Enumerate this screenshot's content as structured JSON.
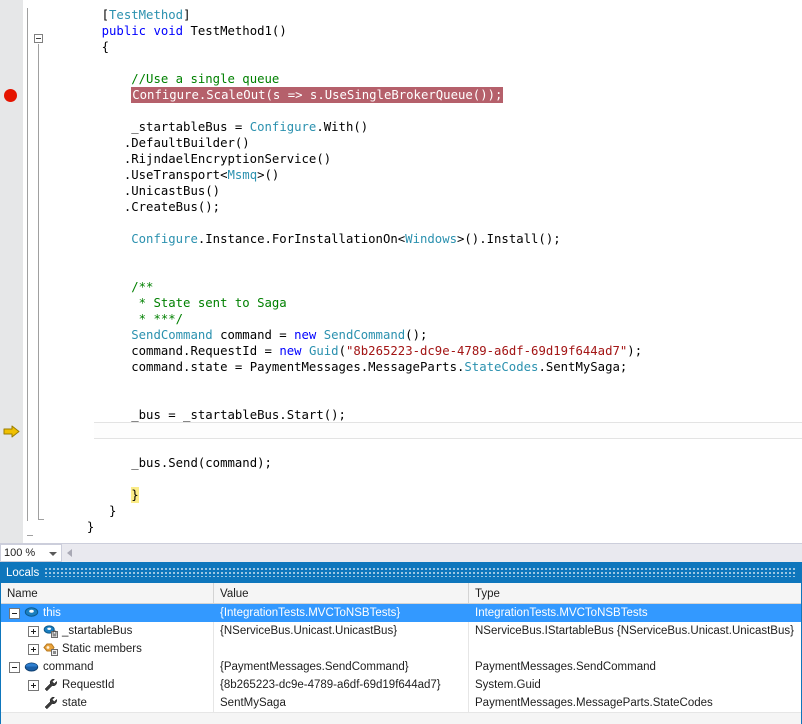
{
  "editor": {
    "language": "csharp",
    "zoom_level": "100 %",
    "breakpoint_line_index": 5,
    "current_statement_line_index": 26,
    "colors": {
      "keyword": "#0000ff",
      "type": "#2b91af",
      "comment": "#008000",
      "string": "#a31515",
      "breakpoint_highlight_bg": "#b5606b",
      "breakpoint_glyph": "#e51400",
      "current_statement_arrow": "#f0c000",
      "brace_match_highlight": "#fbec88"
    },
    "lines": [
      {
        "indent": 4,
        "tokens": [
          {
            "t": "[",
            "c": "p"
          },
          {
            "t": "TestMethod",
            "c": "t"
          },
          {
            "t": "]",
            "c": "p"
          }
        ]
      },
      {
        "indent": 4,
        "outline": "collapse",
        "tokens": [
          {
            "t": "public",
            "c": "k"
          },
          {
            "t": " ",
            "c": "p"
          },
          {
            "t": "void",
            "c": "k"
          },
          {
            "t": " TestMethod1()",
            "c": "p"
          }
        ]
      },
      {
        "indent": 4,
        "tokens": [
          {
            "t": "{",
            "c": "p"
          }
        ]
      },
      {
        "indent": 0,
        "tokens": []
      },
      {
        "indent": 8,
        "tokens": [
          {
            "t": "//Use a single queue",
            "c": "c"
          }
        ]
      },
      {
        "indent": 8,
        "highlight": true,
        "tokens": [
          {
            "t": "Configure.ScaleOut(s => s.UseSingleBrokerQueue());",
            "c": "p"
          }
        ]
      },
      {
        "indent": 0,
        "tokens": []
      },
      {
        "indent": 8,
        "tokens": [
          {
            "t": "_startableBus = ",
            "c": "p"
          },
          {
            "t": "Configure",
            "c": "t"
          },
          {
            "t": ".With()",
            "c": "p"
          }
        ]
      },
      {
        "indent": 7,
        "tokens": [
          {
            "t": ".DefaultBuilder()",
            "c": "p"
          }
        ]
      },
      {
        "indent": 7,
        "tokens": [
          {
            "t": ".RijndaelEncryptionService()",
            "c": "p"
          }
        ]
      },
      {
        "indent": 7,
        "tokens": [
          {
            "t": ".UseTransport<",
            "c": "p"
          },
          {
            "t": "Msmq",
            "c": "t"
          },
          {
            "t": ">()",
            "c": "p"
          }
        ]
      },
      {
        "indent": 7,
        "tokens": [
          {
            "t": ".UnicastBus()",
            "c": "p"
          }
        ]
      },
      {
        "indent": 7,
        "tokens": [
          {
            "t": ".CreateBus();",
            "c": "p"
          }
        ]
      },
      {
        "indent": 0,
        "tokens": []
      },
      {
        "indent": 8,
        "tokens": [
          {
            "t": "Configure",
            "c": "t"
          },
          {
            "t": ".Instance.ForInstallationOn<",
            "c": "p"
          },
          {
            "t": "Windows",
            "c": "t"
          },
          {
            "t": ">().Install();",
            "c": "p"
          }
        ]
      },
      {
        "indent": 0,
        "tokens": []
      },
      {
        "indent": 0,
        "tokens": []
      },
      {
        "indent": 8,
        "tokens": [
          {
            "t": "/**",
            "c": "c"
          }
        ]
      },
      {
        "indent": 9,
        "tokens": [
          {
            "t": "* State sent to Saga",
            "c": "c"
          }
        ]
      },
      {
        "indent": 9,
        "tokens": [
          {
            "t": "* ***/",
            "c": "c"
          }
        ]
      },
      {
        "indent": 8,
        "tokens": [
          {
            "t": "SendCommand",
            "c": "t"
          },
          {
            "t": " command = ",
            "c": "p"
          },
          {
            "t": "new",
            "c": "k"
          },
          {
            "t": " ",
            "c": "p"
          },
          {
            "t": "SendCommand",
            "c": "t"
          },
          {
            "t": "();",
            "c": "p"
          }
        ]
      },
      {
        "indent": 8,
        "tokens": [
          {
            "t": "command.RequestId = ",
            "c": "p"
          },
          {
            "t": "new",
            "c": "k"
          },
          {
            "t": " ",
            "c": "p"
          },
          {
            "t": "Guid",
            "c": "t"
          },
          {
            "t": "(",
            "c": "p"
          },
          {
            "t": "\"8b265223-dc9e-4789-a6df-69d19f644ad7\"",
            "c": "s"
          },
          {
            "t": ");",
            "c": "p"
          }
        ]
      },
      {
        "indent": 8,
        "tokens": [
          {
            "t": "command.state = PaymentMessages.MessageParts.",
            "c": "p"
          },
          {
            "t": "StateCodes",
            "c": "t"
          },
          {
            "t": ".SentMySaga;",
            "c": "p"
          }
        ]
      },
      {
        "indent": 0,
        "tokens": []
      },
      {
        "indent": 0,
        "tokens": []
      },
      {
        "indent": 8,
        "tokens": [
          {
            "t": "_bus = _startableBus.Start();",
            "c": "p"
          }
        ]
      },
      {
        "indent": 0,
        "tokens": []
      },
      {
        "indent": 0,
        "tokens": []
      },
      {
        "indent": 8,
        "tokens": [
          {
            "t": "_bus.Send(command);",
            "c": "p"
          }
        ]
      },
      {
        "indent": 0,
        "tokens": []
      },
      {
        "indent": 8,
        "current": true,
        "tokens": [
          {
            "t": "}",
            "c": "p",
            "brace": true
          }
        ]
      },
      {
        "indent": 5,
        "tokens": [
          {
            "t": "}",
            "c": "p"
          }
        ]
      },
      {
        "indent": 2,
        "tokens": [
          {
            "t": "}",
            "c": "p"
          }
        ]
      }
    ]
  },
  "locals": {
    "title": "Locals",
    "columns": [
      "Name",
      "Value",
      "Type"
    ],
    "rows": [
      {
        "name": "this",
        "value": "{IntegrationTests.MVCToNSBTests}",
        "type": "IntegrationTests.MVCToNSBTests",
        "depth": 0,
        "expander": "minus",
        "icon": "class-object-icon",
        "selected": true
      },
      {
        "name": "_startableBus",
        "value": "{NServiceBus.Unicast.UnicastBus}",
        "type": "NServiceBus.IStartableBus {NServiceBus.Unicast.UnicastBus}",
        "depth": 1,
        "expander": "plus",
        "icon": "private-field-icon",
        "selected": false
      },
      {
        "name": "Static members",
        "value": "",
        "type": "",
        "depth": 1,
        "expander": "plus",
        "icon": "static-members-icon",
        "selected": false
      },
      {
        "name": "command",
        "value": "{PaymentMessages.SendCommand}",
        "type": "PaymentMessages.SendCommand",
        "depth": 0,
        "expander": "minus",
        "icon": "object-icon",
        "selected": false
      },
      {
        "name": "RequestId",
        "value": "{8b265223-dc9e-4789-a6df-69d19f644ad7}",
        "type": "System.Guid",
        "depth": 1,
        "expander": "plus",
        "icon": "property-icon",
        "selected": false
      },
      {
        "name": "state",
        "value": "SentMySaga",
        "type": "PaymentMessages.MessageParts.StateCodes",
        "depth": 1,
        "expander": "none",
        "icon": "property-icon",
        "selected": false
      }
    ]
  }
}
